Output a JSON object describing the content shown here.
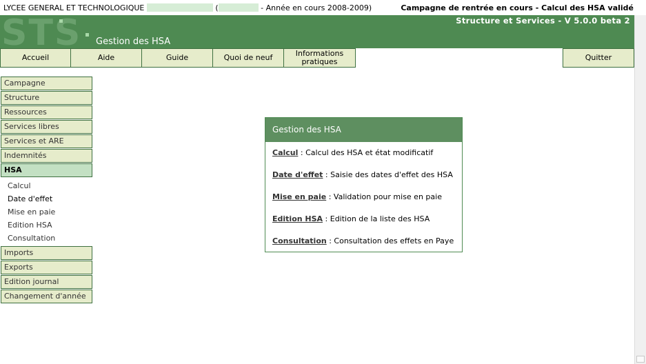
{
  "topbar": {
    "school": "LYCEE GENERAL ET TECHNOLOGIQUE",
    "open_paren": "(",
    "year_text": "- Année en cours 2008-2009)",
    "status": "Campagne de rentrée en cours - Calcul des HSA validé"
  },
  "header": {
    "logo": "STS",
    "title": "Gestion des HSA",
    "version": "Structure et Services - V 5.0.0 beta 2",
    "color": "#4e8a52"
  },
  "menu": {
    "items": [
      {
        "label": "Accueil"
      },
      {
        "label": "Aide"
      },
      {
        "label": "Guide"
      },
      {
        "label": "Quoi de neuf"
      },
      {
        "label": "Informations pratiques"
      }
    ],
    "quit_label": "Quitter"
  },
  "sidebar": {
    "items_before": [
      {
        "label": "Campagne"
      },
      {
        "label": "Structure"
      },
      {
        "label": "Ressources"
      },
      {
        "label": "Services libres"
      },
      {
        "label": "Services et ARE"
      },
      {
        "label": "Indemnités"
      }
    ],
    "active": {
      "label": "HSA"
    },
    "subitems": [
      {
        "label": "Calcul"
      },
      {
        "label": "Date d'effet"
      },
      {
        "label": "Mise en paie"
      },
      {
        "label": "Edition HSA"
      },
      {
        "label": "Consultation"
      }
    ],
    "items_after": [
      {
        "label": "Imports"
      },
      {
        "label": "Exports"
      },
      {
        "label": "Edition journal"
      },
      {
        "label": "Changement d'année"
      }
    ]
  },
  "panel": {
    "title": "Gestion des HSA",
    "rows": [
      {
        "link": "Calcul",
        "desc": " : Calcul des HSA et état modificatif"
      },
      {
        "link": "Date d'effet",
        "desc": " : Saisie des dates d'effet des HSA"
      },
      {
        "link": "Mise en paie",
        "desc": " : Validation pour mise en paie"
      },
      {
        "link": "Edition HSA",
        "desc": " : Edition de la liste des HSA"
      },
      {
        "link": "Consultation",
        "desc": " : Consultation des effets en Paye"
      }
    ]
  }
}
